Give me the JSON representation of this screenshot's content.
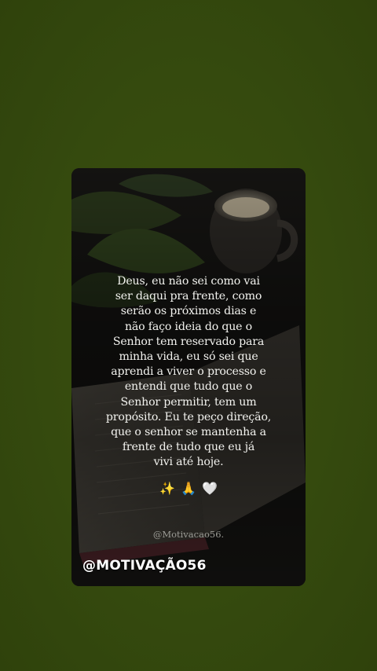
{
  "story": {
    "quote_lines": [
      "Deus, eu não sei como vai",
      "ser daqui pra frente, como",
      "serão os próximos dias e",
      "não faço ideia do que o",
      "Senhor tem reservado para",
      "minha vida, eu só sei que",
      "aprendi a viver o processo e",
      "entendi que tudo que o",
      "Senhor permitir, tem um",
      "propósito. Eu te peço direção,",
      "que o senhor se mantenha a",
      "frente de tudo que eu já",
      "vivi até hoje."
    ],
    "emojis": [
      "✨",
      "🙏",
      "🤍"
    ],
    "credit": "@Motivacao56.",
    "handle": "@MOTIVAÇÃO56"
  },
  "colors": {
    "page_background": "#374a10",
    "quote_text": "#f2f2ee",
    "credit_text": "#9c9c96",
    "handle_text": "#ffffff"
  }
}
